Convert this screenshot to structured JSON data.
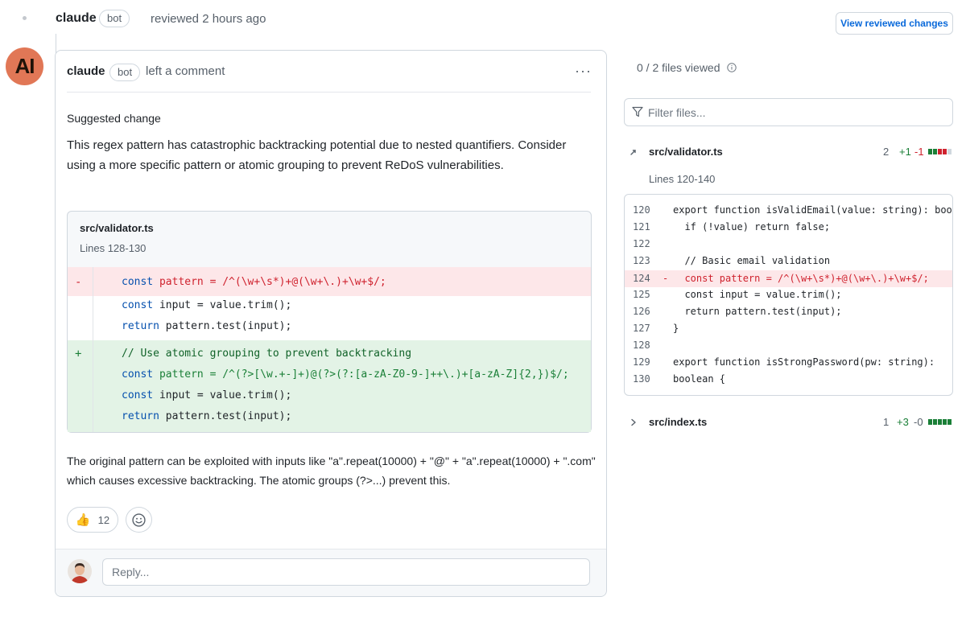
{
  "header": {
    "user": "claude",
    "badge": "bot",
    "action": "reviewed 2 hours ago",
    "view_button": "View reviewed changes"
  },
  "comment": {
    "avatar_text": "AI",
    "user": "claude",
    "badge": "bot",
    "action": "left a comment",
    "menu": "···",
    "suggested_label": "Suggested change",
    "body": "This regex pattern has catastrophic backtracking potential due to nested quantifiers. Consider using a more specific pattern or atomic grouping to prevent ReDoS vulnerabilities.",
    "suggestion": {
      "file": "src/validator.ts",
      "lines": "Lines 128-130",
      "removed": [
        {
          "sym": "-",
          "code": "const pattern = /^(\\w+\\s*)+@(\\w+\\.)+\\w+$/;"
        }
      ],
      "context": [
        "const input = value.trim();",
        "return pattern.test(input);"
      ],
      "added": [
        {
          "sym": "+",
          "code": "// Use atomic grouping to prevent backtracking"
        },
        {
          "sym": "",
          "code": "const pattern = /^(?>[\\w.+-]+)@(?>(?:[a-zA-Z0-9-]++\\.)+[a-zA-Z]{2,})$/;"
        },
        {
          "sym": "",
          "code": "const input = value.trim();"
        },
        {
          "sym": "",
          "code": "return pattern.test(input);"
        }
      ]
    },
    "after": "The original pattern can be exploited with inputs like \"a\".repeat(10000) + \"@\" + \"a\".repeat(10000) + \".com\" which causes excessive backtracking. The atomic groups (?>...) prevent this.",
    "reaction": {
      "emoji": "👍",
      "count": "12",
      "icon": "thumbs-up-icon"
    },
    "add_reaction_icon": "smiley-icon",
    "reply_placeholder": "Reply..."
  },
  "sidebar": {
    "files_viewed": "0 / 2 files viewed",
    "filter_placeholder": "Filter files...",
    "files": [
      {
        "name": "src/validator.ts",
        "count": "2",
        "add": "+1",
        "del": "-1",
        "expanded": true
      },
      {
        "name": "src/index.ts",
        "count": "1",
        "add": "+3",
        "del": "-0",
        "expanded": false
      }
    ],
    "lines_label": "Lines 120-140",
    "code_rows": [
      {
        "num": "120",
        "sym": "",
        "code": "export function isValidEmail(value: string): boolean {",
        "removed": false
      },
      {
        "num": "121",
        "sym": "",
        "code": "  if (!value) return false;",
        "removed": false
      },
      {
        "num": "122",
        "sym": "",
        "code": "",
        "removed": false
      },
      {
        "num": "123",
        "sym": "",
        "code": "  // Basic email validation",
        "removed": false
      },
      {
        "num": "124",
        "sym": "-",
        "code": "  const pattern = /^(\\w+\\s*)+@(\\w+\\.)+\\w+$/;",
        "removed": true
      },
      {
        "num": "125",
        "sym": "",
        "code": "  const input = value.trim();",
        "removed": false
      },
      {
        "num": "126",
        "sym": "",
        "code": "  return pattern.test(input);",
        "removed": false
      },
      {
        "num": "127",
        "sym": "",
        "code": "}",
        "removed": false
      },
      {
        "num": "128",
        "sym": "",
        "code": "",
        "removed": false
      },
      {
        "num": "129",
        "sym": "",
        "code": "export function isStrongPassword(pw: string):",
        "removed": false
      },
      {
        "num": "130",
        "sym": "",
        "code": "boolean {",
        "removed": false
      }
    ]
  },
  "colors": {
    "accent": "#0969da",
    "added": "#1a7f37",
    "removed": "#cf222e",
    "avatar": "#e17756"
  }
}
